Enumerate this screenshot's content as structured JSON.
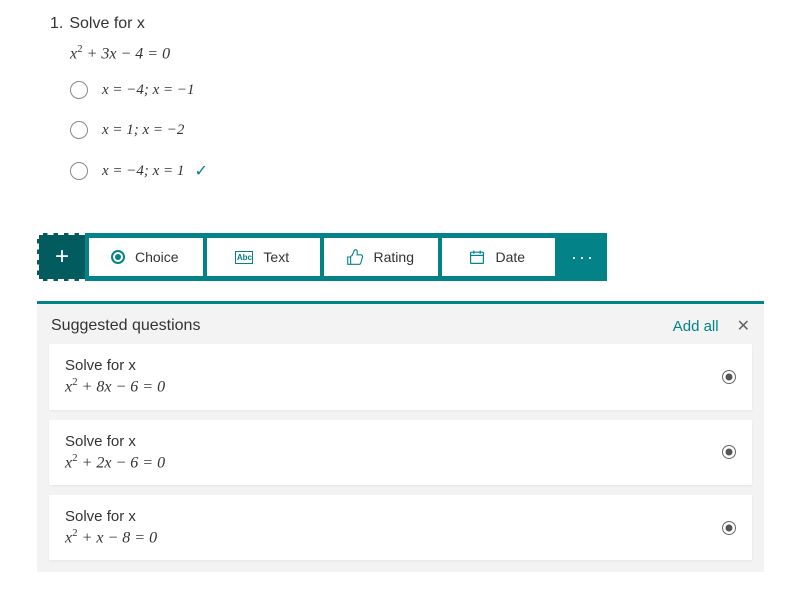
{
  "question": {
    "number": "1.",
    "title": "Solve for x",
    "equation_html": "x<span class='sup'>2</span> + 3x − 4 = 0",
    "options": [
      {
        "text": "x = −4; x = −1",
        "correct": false
      },
      {
        "text": "x = 1; x = −2",
        "correct": false
      },
      {
        "text": "x = −4; x = 1",
        "correct": true
      }
    ]
  },
  "toolbar": {
    "choice": "Choice",
    "text": "Text",
    "rating": "Rating",
    "date": "Date"
  },
  "suggested": {
    "header": "Suggested questions",
    "add_all": "Add all",
    "items": [
      {
        "title": "Solve for x",
        "equation_html": "x<span class='sup'>2</span> + 8x − 6 = 0"
      },
      {
        "title": "Solve for x",
        "equation_html": "x<span class='sup'>2</span> + 2x − 6 = 0"
      },
      {
        "title": "Solve for x",
        "equation_html": "x<span class='sup'>2</span> + x − 8 = 0"
      }
    ]
  }
}
